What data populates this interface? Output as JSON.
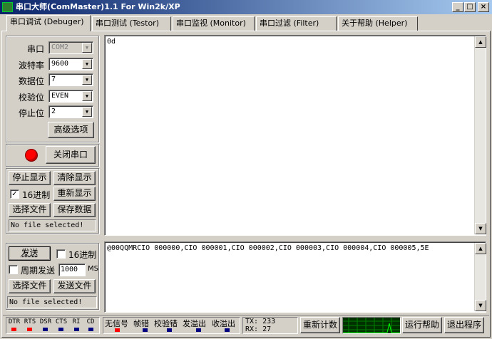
{
  "window": {
    "title": "串口大师(ComMaster)1.1 For Win2k/XP",
    "icon": "app-icon",
    "minimize": "_",
    "maximize": "□",
    "close": "×"
  },
  "tabs": [
    {
      "label": "串口调试 (Debuger)",
      "active": true
    },
    {
      "label": "串口测试 (Testor)"
    },
    {
      "label": "串口监视 (Monitor)"
    },
    {
      "label": "串口过滤 (Filter)"
    },
    {
      "label": "关于帮助 (Helper)"
    }
  ],
  "settings": {
    "port_label": "串口",
    "port_value": "COM2",
    "baud_label": "波特率",
    "baud_value": "9600",
    "databits_label": "数据位",
    "databits_value": "7",
    "parity_label": "校验位",
    "parity_value": "EVEN",
    "stopbits_label": "停止位",
    "stopbits_value": "2",
    "advanced_button": "高级选项"
  },
  "port_control": {
    "close_port_button": "关闭串口",
    "status_color": "#ff0000"
  },
  "receive_controls": {
    "stop_display": "停止显示",
    "clear_display": "清除显示",
    "hex_label": "16进制",
    "hex_checked": true,
    "redisplay": "重新显示",
    "choose_file": "选择文件",
    "save_data": "保存数据",
    "file_status": "No file selected!"
  },
  "receive_area": {
    "text": "0d"
  },
  "send_area": {
    "text": "@00QQMRCIO 000000,CIO 000001,CIO 000002,CIO 000003,CIO 000004,CIO 000005,5E"
  },
  "send_controls": {
    "send_button": "发送",
    "hex_label": "16进制",
    "hex_checked": false,
    "periodic_label": "周期发送",
    "periodic_checked": false,
    "period_value": "1000",
    "period_unit": "MS",
    "choose_file": "选择文件",
    "send_file": "发送文件",
    "file_status": "No file selected!"
  },
  "status_bar": {
    "signals": [
      {
        "name": "DTR",
        "color": "#ff0000"
      },
      {
        "name": "RTS",
        "color": "#ff0000"
      },
      {
        "name": "DSR",
        "color": "#000080"
      },
      {
        "name": "CTS",
        "color": "#000080"
      },
      {
        "name": "RI",
        "color": "#000080"
      },
      {
        "name": "CD",
        "color": "#000080"
      }
    ],
    "errors": [
      {
        "name": "无信号",
        "color": "#ff0000"
      },
      {
        "name": "帧错",
        "color": "#000080"
      },
      {
        "name": "校验错",
        "color": "#000080"
      },
      {
        "name": "发溢出",
        "color": "#000080"
      },
      {
        "name": "收溢出",
        "color": "#000080"
      }
    ],
    "tx": "TX: 233",
    "rx": "RX: 27",
    "recount_button": "重新计数",
    "run_help_button": "运行帮助",
    "exit_button": "退出程序"
  },
  "colors": {
    "titlebar_start": "#0a246a",
    "titlebar_end": "#a6caf0",
    "graph_bg": "#003000",
    "graph_grid": "#008000",
    "graph_line": "#00ff00"
  }
}
